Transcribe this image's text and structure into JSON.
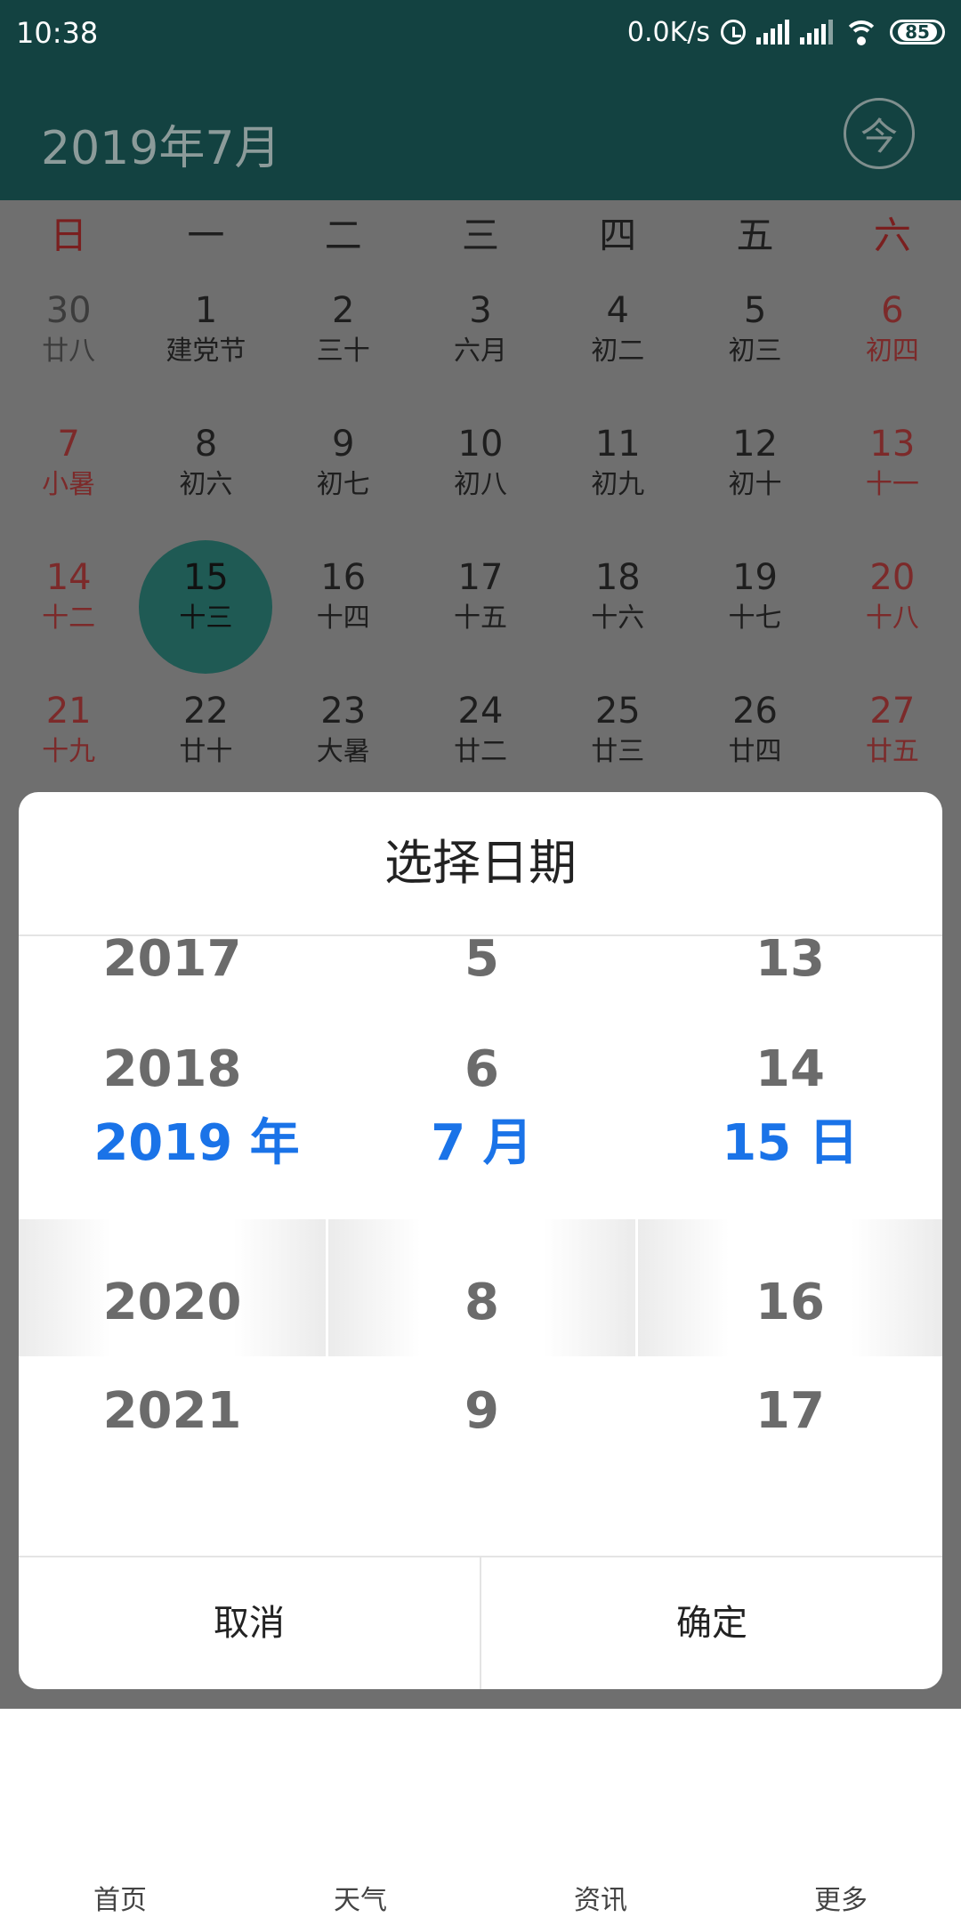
{
  "status_bar": {
    "time": "10:38",
    "speed": "0.0K/s",
    "battery": "85"
  },
  "header": {
    "month_title": "2019年7月",
    "today_label": "今"
  },
  "calendar": {
    "weekdays": [
      "日",
      "一",
      "二",
      "三",
      "四",
      "五",
      "六"
    ],
    "weeks": [
      [
        {
          "day": "30",
          "lunar": "廿八",
          "muted": true
        },
        {
          "day": "1",
          "lunar": "建党节"
        },
        {
          "day": "2",
          "lunar": "三十"
        },
        {
          "day": "3",
          "lunar": "六月"
        },
        {
          "day": "4",
          "lunar": "初二"
        },
        {
          "day": "5",
          "lunar": "初三"
        },
        {
          "day": "6",
          "lunar": "初四"
        }
      ],
      [
        {
          "day": "7",
          "lunar": "小暑"
        },
        {
          "day": "8",
          "lunar": "初六"
        },
        {
          "day": "9",
          "lunar": "初七"
        },
        {
          "day": "10",
          "lunar": "初八"
        },
        {
          "day": "11",
          "lunar": "初九"
        },
        {
          "day": "12",
          "lunar": "初十"
        },
        {
          "day": "13",
          "lunar": "十一"
        }
      ],
      [
        {
          "day": "14",
          "lunar": "十二"
        },
        {
          "day": "15",
          "lunar": "十三",
          "selected": true
        },
        {
          "day": "16",
          "lunar": "十四"
        },
        {
          "day": "17",
          "lunar": "十五"
        },
        {
          "day": "18",
          "lunar": "十六"
        },
        {
          "day": "19",
          "lunar": "十七"
        },
        {
          "day": "20",
          "lunar": "十八"
        }
      ],
      [
        {
          "day": "21",
          "lunar": "十九"
        },
        {
          "day": "22",
          "lunar": "廿十"
        },
        {
          "day": "23",
          "lunar": "大暑"
        },
        {
          "day": "24",
          "lunar": "廿二"
        },
        {
          "day": "25",
          "lunar": "廿三"
        },
        {
          "day": "26",
          "lunar": "廿四"
        },
        {
          "day": "27",
          "lunar": "廿五"
        }
      ]
    ]
  },
  "bottom_nav": [
    "首页",
    "天气",
    "资讯",
    "更多"
  ],
  "dialog": {
    "title": "选择日期",
    "year_column": [
      "2017",
      "2018",
      "2020",
      "2021"
    ],
    "month_column": [
      "5",
      "6",
      "8",
      "9"
    ],
    "day_column": [
      "13",
      "14",
      "16",
      "17"
    ],
    "selected_year": "2019 年",
    "selected_month": "7 月",
    "selected_day": "15 日",
    "cancel_label": "取消",
    "ok_label": "确定"
  }
}
